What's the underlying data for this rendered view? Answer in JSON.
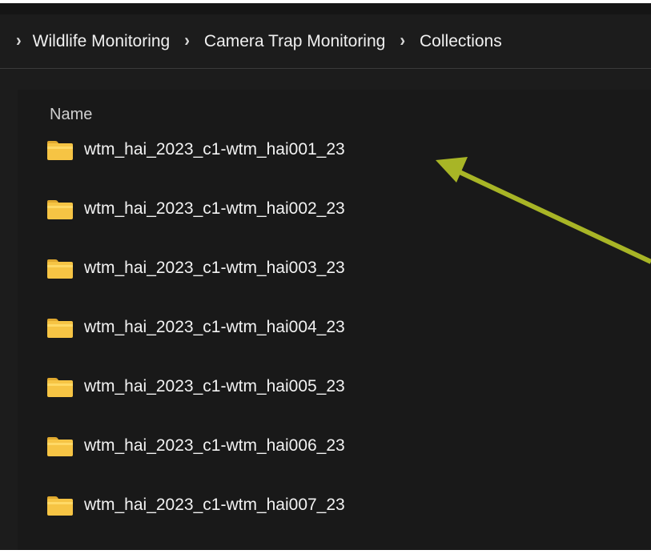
{
  "breadcrumb": {
    "items": [
      "Wildlife Monitoring",
      "Camera Trap Monitoring",
      "Collections"
    ]
  },
  "list": {
    "column_header": "Name",
    "folders": [
      "wtm_hai_2023_c1-wtm_hai001_23",
      "wtm_hai_2023_c1-wtm_hai002_23",
      "wtm_hai_2023_c1-wtm_hai003_23",
      "wtm_hai_2023_c1-wtm_hai004_23",
      "wtm_hai_2023_c1-wtm_hai005_23",
      "wtm_hai_2023_c1-wtm_hai006_23",
      "wtm_hai_2023_c1-wtm_hai007_23"
    ]
  },
  "icons": {
    "breadcrumb_separator": "chevron-right-icon",
    "folder": "folder-icon"
  },
  "colors": {
    "background": "#1c1c1c",
    "folder": "#f6c444",
    "annotation_arrow": "#a8b526"
  },
  "annotation": {
    "type": "arrow",
    "target": "wtm_hai_2023_c1-wtm_hai001_23"
  }
}
